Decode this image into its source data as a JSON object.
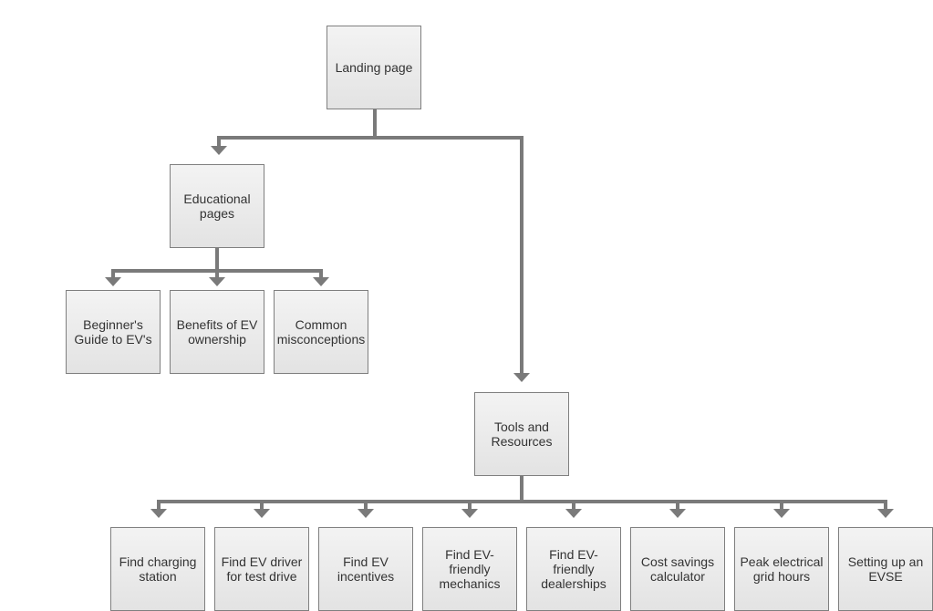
{
  "diagram": {
    "type": "sitemap-tree",
    "colors": {
      "connector": "#7a7a7a",
      "node_border": "#7f7f7f",
      "node_fill_top": "#f3f3f3",
      "node_fill_bottom": "#e3e3e3",
      "text": "#333333"
    },
    "root": {
      "label": "Landing page"
    },
    "educational": {
      "label": "Educational\npages",
      "children": [
        {
          "label": "Beginner's\nGuide to EV's"
        },
        {
          "label": "Benefits of EV\nownership"
        },
        {
          "label": "Common\nmisconceptions"
        }
      ]
    },
    "tools": {
      "label": "Tools and\nResources",
      "children": [
        {
          "label": "Find charging\nstation"
        },
        {
          "label": "Find EV driver\nfor test drive"
        },
        {
          "label": "Find EV\nincentives"
        },
        {
          "label": "Find EV-\nfriendly\nmechanics"
        },
        {
          "label": "Find EV-\nfriendly\ndealerships"
        },
        {
          "label": "Cost savings\ncalculator"
        },
        {
          "label": "Peak electrical\ngrid hours"
        },
        {
          "label": "Setting up an\nEVSE"
        }
      ]
    },
    "edges": [
      {
        "from": "Landing page",
        "to": "Educational pages"
      },
      {
        "from": "Landing page",
        "to": "Tools and Resources"
      },
      {
        "from": "Educational pages",
        "to": "Beginner's Guide to EV's"
      },
      {
        "from": "Educational pages",
        "to": "Benefits of EV ownership"
      },
      {
        "from": "Educational pages",
        "to": "Common misconceptions"
      },
      {
        "from": "Tools and Resources",
        "to": "Find charging station"
      },
      {
        "from": "Tools and Resources",
        "to": "Find EV driver for test drive"
      },
      {
        "from": "Tools and Resources",
        "to": "Find EV incentives"
      },
      {
        "from": "Tools and Resources",
        "to": "Find EV-friendly mechanics"
      },
      {
        "from": "Tools and Resources",
        "to": "Find EV-friendly dealerships"
      },
      {
        "from": "Tools and Resources",
        "to": "Cost savings calculator"
      },
      {
        "from": "Tools and Resources",
        "to": "Peak electrical grid hours"
      },
      {
        "from": "Tools and Resources",
        "to": "Setting up an EVSE"
      }
    ]
  }
}
